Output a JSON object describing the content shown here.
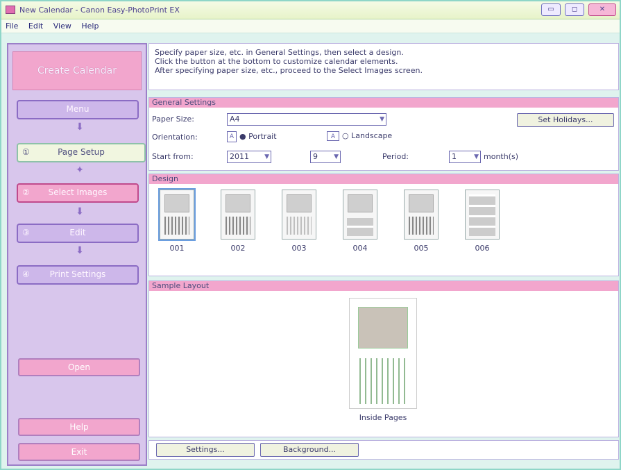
{
  "window": {
    "title": "New Calendar - Canon Easy-PhotoPrint EX",
    "buttons": {
      "minimize": "▭",
      "maximize": "◻",
      "close": "✕"
    }
  },
  "menu": [
    "File",
    "Edit",
    "View",
    "Help"
  ],
  "left": {
    "title": "Create Calendar",
    "menu_label": "Menu",
    "steps": [
      {
        "num": "①",
        "label": "Page Setup"
      },
      {
        "num": "②",
        "label": "Select Images"
      },
      {
        "num": "③",
        "label": "Edit"
      },
      {
        "num": "④",
        "label": "Print Settings"
      }
    ],
    "open_label": "Open",
    "help_label": "Help",
    "exit_label": "Exit"
  },
  "description": {
    "lines": [
      "Specify paper size, etc. in General Settings, then select a design.",
      "Click the button at the bottom to customize calendar elements.",
      "After specifying paper size, etc., proceed to the Select Images screen."
    ]
  },
  "general": {
    "header": "General Settings",
    "paper_size_label": "Paper Size:",
    "paper_size_value": "A4",
    "orientation_label": "Orientation:",
    "portrait_label": "Portrait",
    "landscape_label": "Landscape",
    "set_holidays_label": "Set Holidays...",
    "start_from_label": "Start from:",
    "start_year": "2011",
    "start_month": "9",
    "period_label": "Period:",
    "period_value": "1",
    "period_unit": "month(s)"
  },
  "design": {
    "header": "Design",
    "items": [
      "001",
      "002",
      "003",
      "004",
      "005",
      "006"
    ]
  },
  "sample": {
    "header": "Sample Layout",
    "caption": "Inside Pages"
  },
  "bottom": {
    "settings_label": "Settings...",
    "background_label": "Background..."
  }
}
